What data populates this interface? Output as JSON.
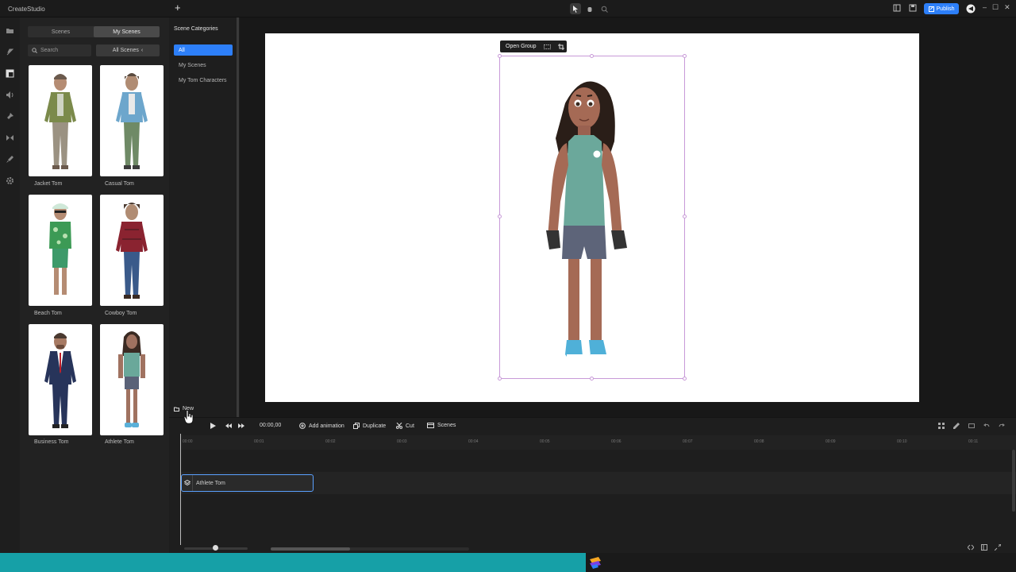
{
  "app": {
    "title": "CreateStudio",
    "publish_label": "Publish",
    "window_controls": [
      "–",
      "☐",
      "✕"
    ]
  },
  "panel": {
    "tabs": [
      {
        "label": "Scenes",
        "active": false
      },
      {
        "label": "My Scenes",
        "active": true
      }
    ],
    "search_placeholder": "Search",
    "filter_label": "All Scenes",
    "characters": [
      {
        "label": "Jacket Tom"
      },
      {
        "label": "Casual Tom"
      },
      {
        "label": "Beach Tom"
      },
      {
        "label": "Cowboy Tom"
      },
      {
        "label": "Business Tom"
      },
      {
        "label": "Athlete Tom"
      }
    ]
  },
  "categories": {
    "title": "Scene Categories",
    "items": [
      {
        "label": "All",
        "active": true
      },
      {
        "label": "My Scenes",
        "active": false
      },
      {
        "label": "My Tom Characters",
        "active": false
      }
    ],
    "new_label": "New"
  },
  "stage": {
    "open_group_label": "Open Group"
  },
  "timeline": {
    "time_display": "00:00,00",
    "add_animation_label": "Add animation",
    "duplicate_label": "Duplicate",
    "cut_label": "Cut",
    "scenes_label": "Scenes",
    "ticks": [
      "00:00",
      "00:01",
      "00:02",
      "00:03",
      "00:04",
      "00:05",
      "00:06",
      "00:07",
      "00:08",
      "00:09",
      "00:10",
      "00:11"
    ],
    "clip_label": "Athlete Tom"
  },
  "colors": {
    "accent": "#2d7ff9",
    "selection": "#c89ad8",
    "taskbar": "#16a0a7"
  }
}
